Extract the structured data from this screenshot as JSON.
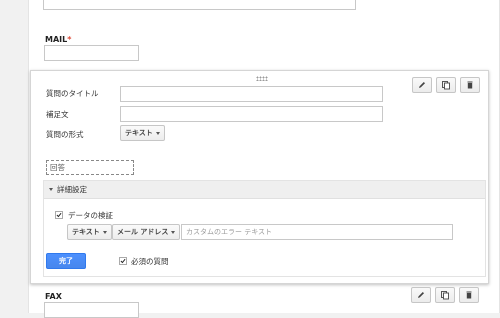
{
  "top_form": {
    "mail_label": "MAIL",
    "required_mark": "*"
  },
  "editor": {
    "title_label": "質問のタイトル",
    "help_label": "補足文",
    "type_label": "質問の形式",
    "type_value": "テキスト",
    "answer_label": "回答",
    "advanced_label": "詳細設定",
    "validation_label": "データの検証",
    "validation_type": "テキスト",
    "validation_rule": "メール アドレス",
    "custom_error_placeholder": "カスタムのエラー テキスト",
    "done_label": "完了",
    "required_label": "必須の質問",
    "validation_checked": true,
    "required_checked": true
  },
  "bottom_form": {
    "fax_label": "FAX"
  },
  "icons": [
    "pencil-icon",
    "duplicate-icon",
    "trash-icon"
  ]
}
